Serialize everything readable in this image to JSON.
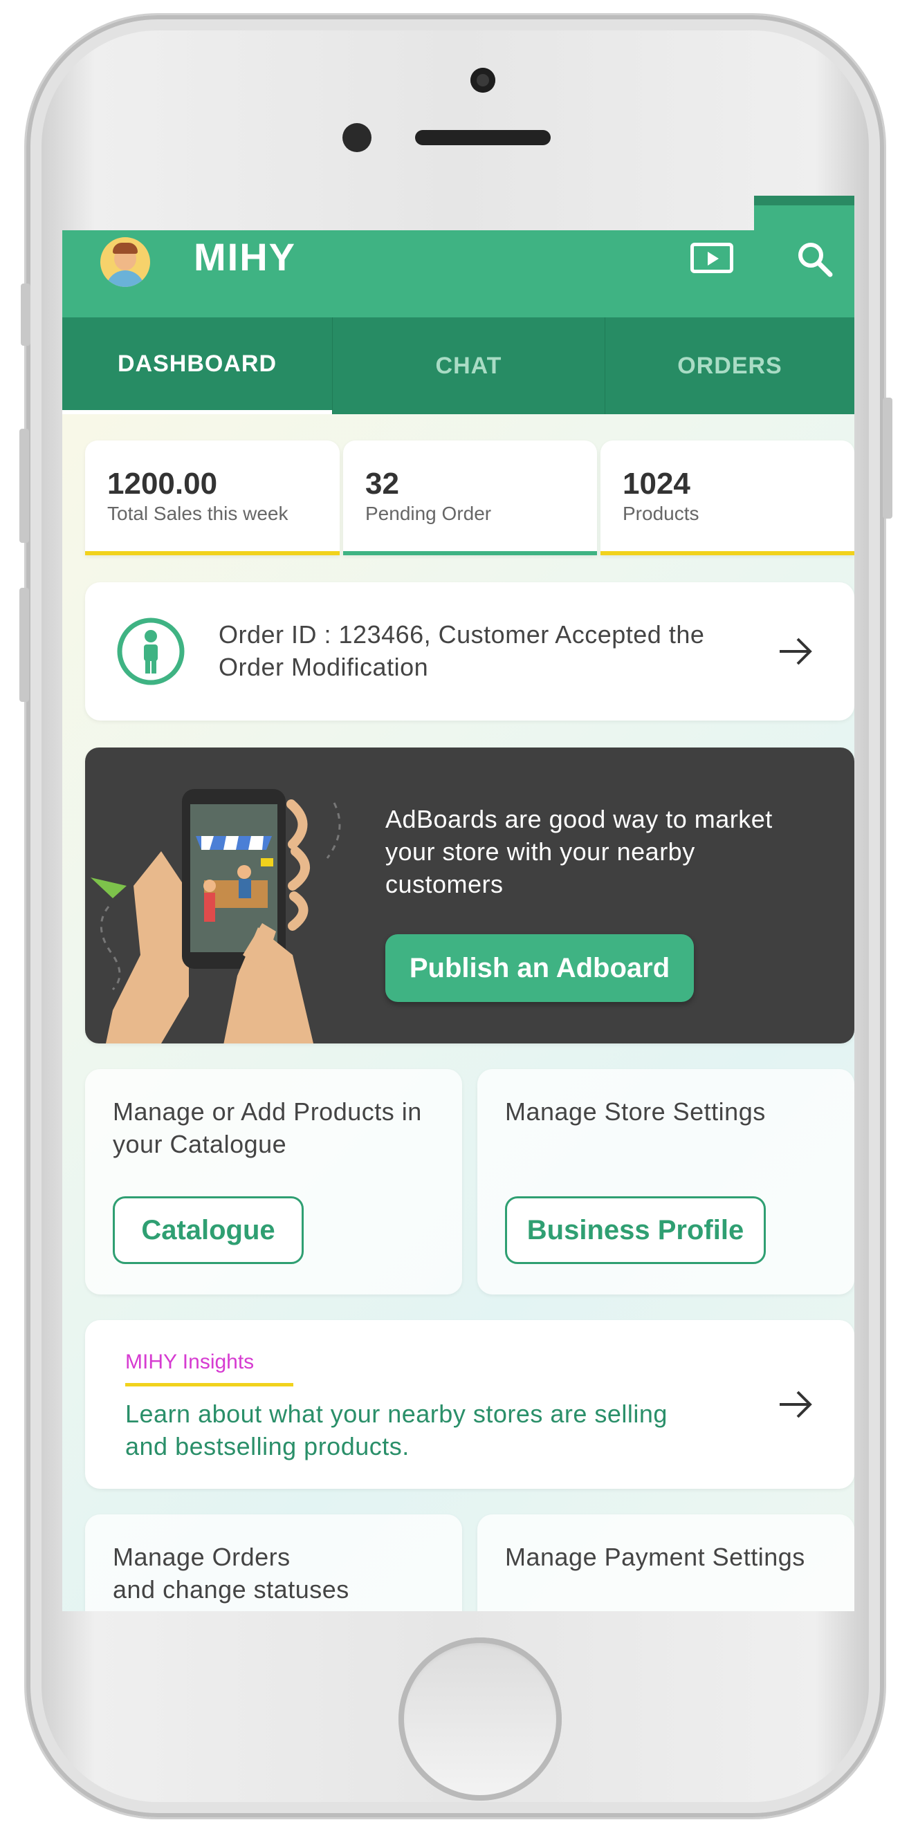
{
  "app": {
    "title": "MIHY"
  },
  "tabs": [
    {
      "label": "DASHBOARD",
      "active": true
    },
    {
      "label": "CHAT",
      "active": false
    },
    {
      "label": "ORDERS",
      "active": false
    }
  ],
  "stats": [
    {
      "value": "1200.00",
      "label": "Total Sales this week",
      "bar_color": "#f1d21c"
    },
    {
      "value": "32",
      "label": "Pending Order",
      "bar_color": "#3fb383"
    },
    {
      "value": "1024",
      "label": "Products",
      "bar_color": "#f1d21c"
    }
  ],
  "order_notice": {
    "text": "Order ID : 123466, Customer Accepted the Order Modification"
  },
  "adboard": {
    "text": "AdBoards are good way to market your store with your nearby customers",
    "button": "Publish an Adboard"
  },
  "catalogue_card": {
    "text": "Manage or Add Products in your Catalogue",
    "button": "Catalogue"
  },
  "store_card": {
    "text": "Manage Store Settings",
    "button": "Business Profile"
  },
  "insights": {
    "tag": "MIHY Insights",
    "text": "Learn about what your nearby stores are selling and bestselling products."
  },
  "orders_card": {
    "text": "Manage Orders\nand change statuses"
  },
  "payment_card": {
    "text": "Manage Payment Settings"
  },
  "colors": {
    "primary": "#3fb383",
    "tab_bg": "#278c64",
    "accent_yellow": "#f1d21c",
    "insight_pink": "#d63bd1"
  },
  "icons": [
    "avatar",
    "cast-icon",
    "search-icon",
    "person-icon",
    "arrow-right-icon",
    "phone-shop-illustration"
  ]
}
